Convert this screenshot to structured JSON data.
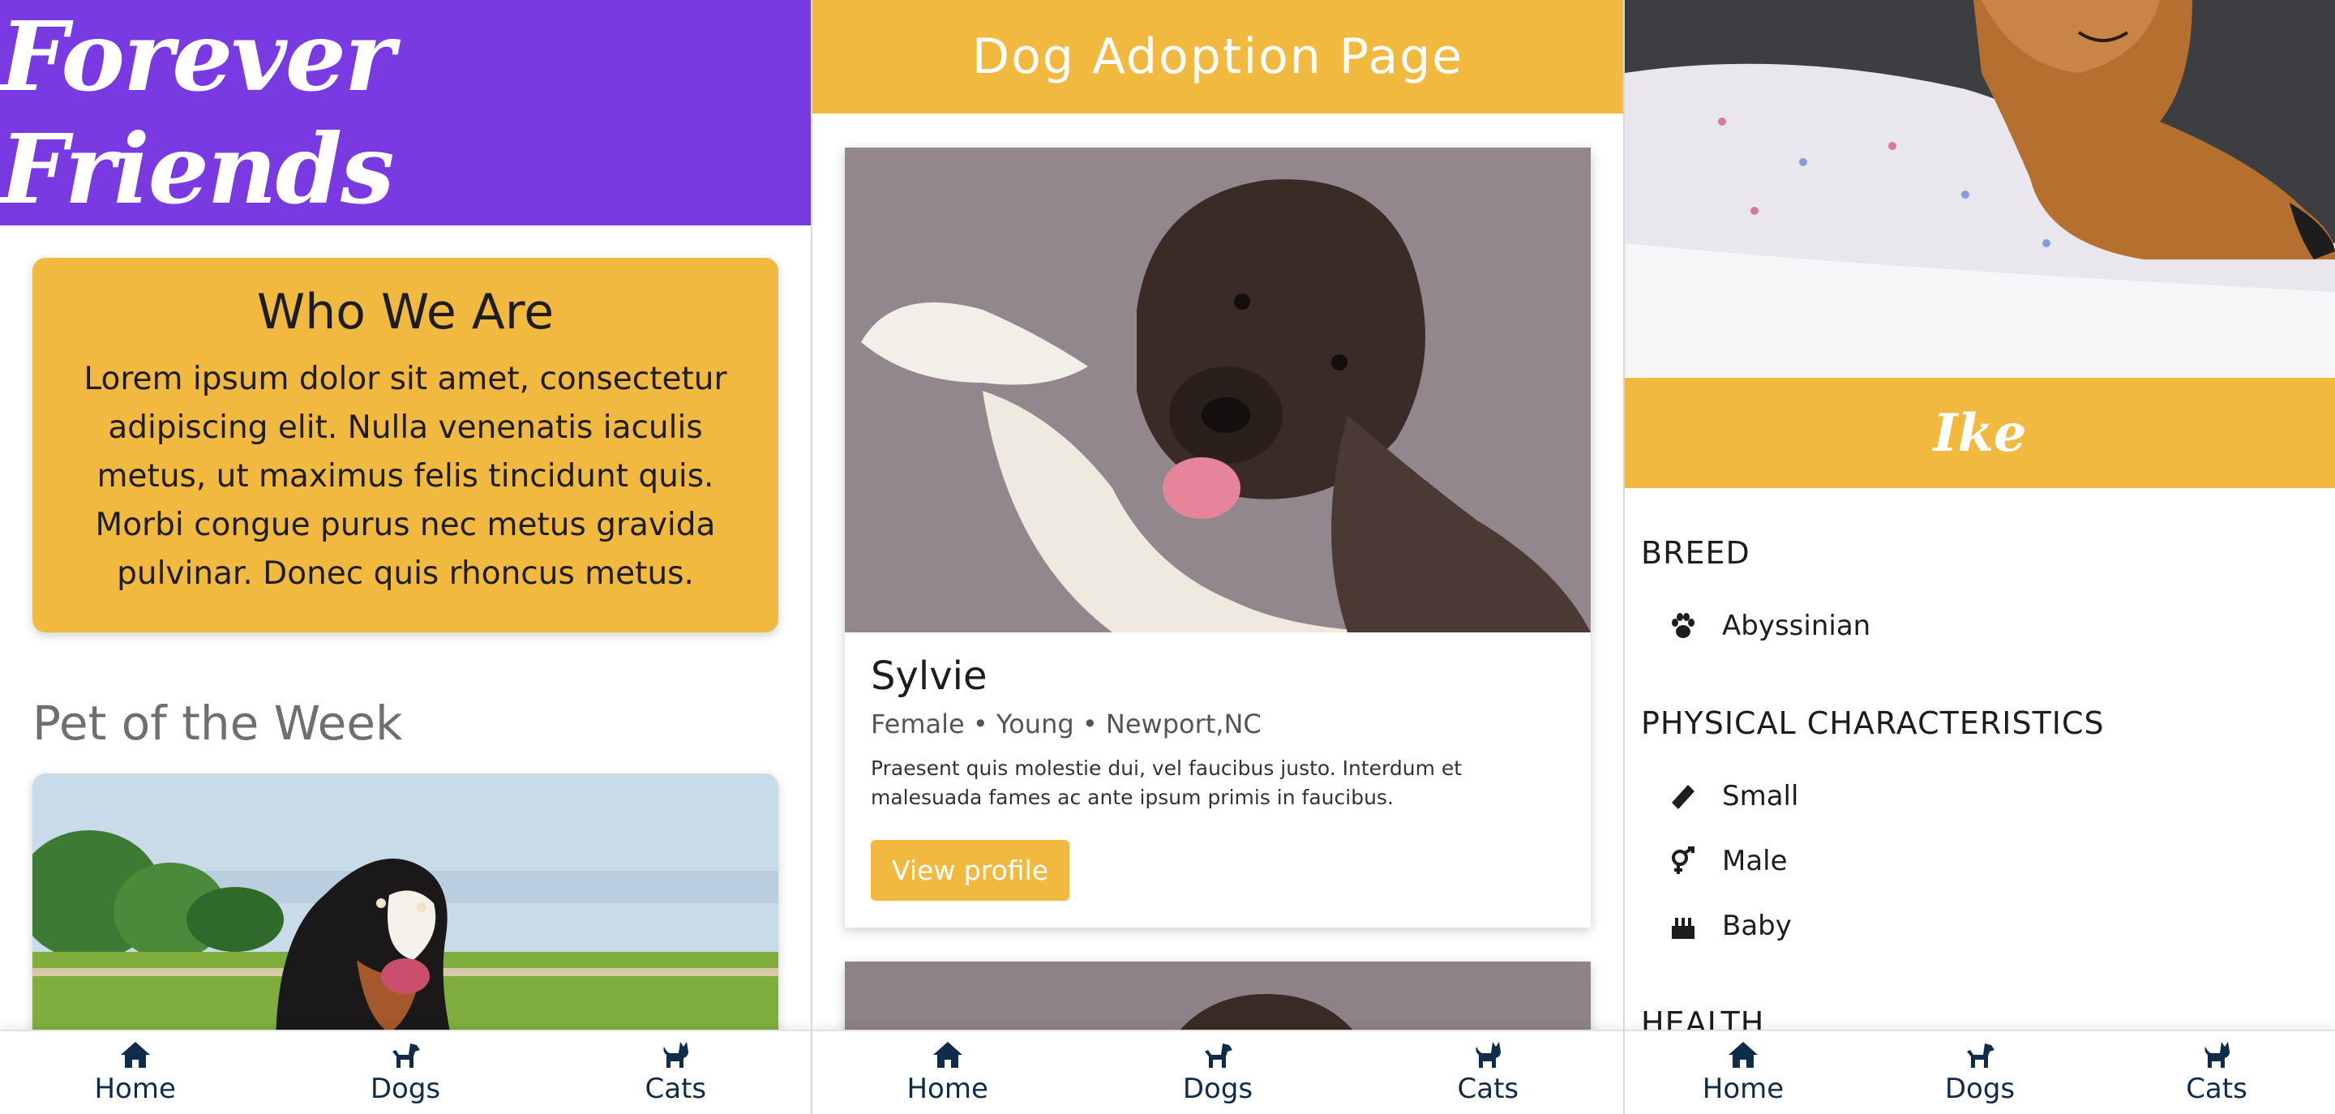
{
  "panel1": {
    "brand": "Forever Friends",
    "about": {
      "title": "Who We Are",
      "body": "Lorem ipsum dolor sit amet, consectetur adipiscing elit. Nulla venenatis iaculis metus, ut maximus felis tincidunt quis. Morbi congue purus nec metus gravida pulvinar. Donec quis rhoncus metus."
    },
    "pet_of_week_title": "Pet of the Week"
  },
  "panel2": {
    "title": "Dog Adoption Page",
    "dog": {
      "name": "Sylvie",
      "meta": "Female • Young • Newport,NC",
      "description": "Praesent quis molestie dui, vel faucibus justo. Interdum et malesuada fames ac ante ipsum primis in faucibus.",
      "button": "View profile"
    }
  },
  "panel3": {
    "cat_name": "Ike",
    "sections": {
      "breed": "BREED",
      "physical": "PHYSICAL CHARACTERISTICS",
      "health": "HEALTH"
    },
    "breed_value": "Abyssinian",
    "physical": {
      "size": "Small",
      "sex": "Male",
      "age": "Baby"
    }
  },
  "nav": {
    "home": "Home",
    "dogs": "Dogs",
    "cats": "Cats"
  },
  "colors": {
    "purple": "#7a3ae2",
    "gold": "#f2b941",
    "navy": "#0f2d4a"
  },
  "icons": [
    "home-icon",
    "dog-icon",
    "cat-icon",
    "paw-icon",
    "ruler-icon",
    "gender-icon",
    "cake-icon"
  ]
}
